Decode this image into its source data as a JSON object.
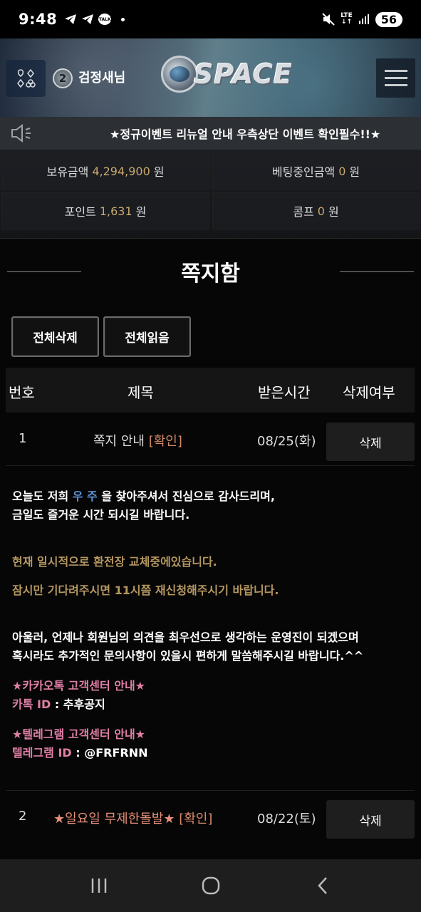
{
  "status_bar": {
    "time": "9:48",
    "talk_badge": "TALK",
    "network": "LTE",
    "battery": "56"
  },
  "header": {
    "rank_number": "2",
    "username": "검정새님",
    "logo_text": "SPACE"
  },
  "notice": {
    "text": "★정규이벤트 리뉴얼 안내 우측상단 이벤트 확인필수!!★"
  },
  "balance": {
    "holding": {
      "label": "보유금액",
      "value": "4,294,900",
      "unit": "원"
    },
    "betting": {
      "label": "베팅중인금액",
      "value": "0",
      "unit": "원"
    },
    "points": {
      "label": "포인트",
      "value": "1,631",
      "unit": "원"
    },
    "comp": {
      "label": "콤프",
      "value": "0",
      "unit": "원"
    }
  },
  "mailbox": {
    "title": "쪽지함",
    "delete_all_label": "전체삭제",
    "read_all_label": "전체읽음",
    "columns": {
      "number": "번호",
      "subject": "제목",
      "received": "받은시간",
      "delete": "삭제여부"
    },
    "rows": [
      {
        "number": "1",
        "subject": "쪽지 안내",
        "status": "[확인]",
        "received": "08/25(화)",
        "delete_label": "삭제"
      },
      {
        "number": "2",
        "subject": "★일요일 무제한돌발★",
        "status": "[확인]",
        "received": "08/22(토)",
        "delete_label": "삭제"
      }
    ],
    "message": {
      "line1_a": "오늘도 저희 ",
      "line1_brand": "우 주",
      "line1_b": " 을 찾아주셔서 진심으로 감사드리며,",
      "line2": "금일도 즐거운 시간 되시길 바랍니다.",
      "line3": "현재 일시적으로 환전장 교체중에있습니다.",
      "line4": "잠시만 기다려주시면 11시쯤 재신청해주시기 바랍니다.",
      "line5": "아울러, 언제나 회원님의 의견을 최우선으로 생각하는 운영진이 되겠으며",
      "line6": "혹시라도 추가적인 문의사항이 있을시 편하게 말씀해주시길 바랍니다.^^",
      "kakao_heading": "★카카오톡 고객센터 안내★",
      "kakao_label": "카톡 ID",
      "kakao_value": " : 추후공지",
      "telegram_heading": "★텔레그램 고객센터 안내★",
      "telegram_label": "텔레그램 ID",
      "telegram_value": " : @FRFRNN"
    }
  },
  "colors": {
    "accent_gold": "#c8a86c",
    "confirm": "#d78a6a",
    "brand_blue": "#5b97d8",
    "pink": "#e07fa6"
  }
}
